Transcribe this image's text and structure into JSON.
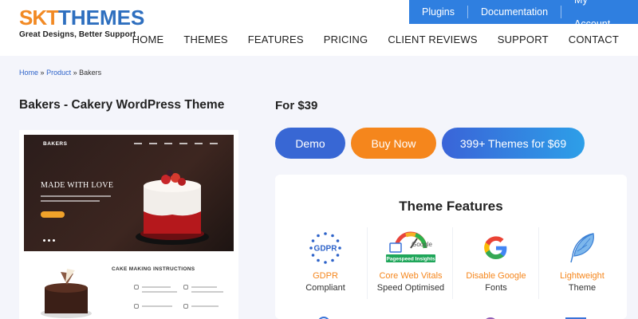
{
  "brand": {
    "logo_part1": "SKT",
    "logo_part2": "THEMES",
    "tagline": "Great Designs, Better Support"
  },
  "topbar": {
    "items": [
      "Plugins",
      "Documentation",
      "My Account"
    ]
  },
  "nav": {
    "items": [
      "HOME",
      "THEMES",
      "FEATURES",
      "PRICING",
      "CLIENT REVIEWS",
      "SUPPORT",
      "CONTACT"
    ]
  },
  "breadcrumb": {
    "home": "Home",
    "product": "Product",
    "current": "Bakers",
    "separator": "»"
  },
  "product": {
    "title": "Bakers - Cakery WordPress Theme",
    "price": "For $39"
  },
  "buttons": {
    "demo": "Demo",
    "buy": "Buy Now",
    "bundle": "399+ Themes for $69"
  },
  "preview": {
    "brand": "BAKERS",
    "hero_text": "MADE WITH LOVE",
    "section_title": "CAKE MAKING INSTRUCTIONS"
  },
  "features": {
    "heading": "Theme Features",
    "items": [
      {
        "line1": "GDPR",
        "line2": "Compliant",
        "icon": "gdpr-icon"
      },
      {
        "line1": "Core Web Vitals",
        "line2": "Speed Optimised",
        "icon": "pagespeed-icon"
      },
      {
        "line1": "Disable Google",
        "line2": "Fonts",
        "icon": "google-icon"
      },
      {
        "line1": "Lightweight",
        "line2": "Theme",
        "icon": "feather-icon"
      }
    ],
    "gdpr_badge": "GDPR",
    "pagespeed_badge": "Pagespeed Insights",
    "google_word": "Google"
  },
  "colors": {
    "accent_blue": "#2f7fe0",
    "accent_orange": "#f5861c",
    "demo_blue": "#3867d4"
  }
}
